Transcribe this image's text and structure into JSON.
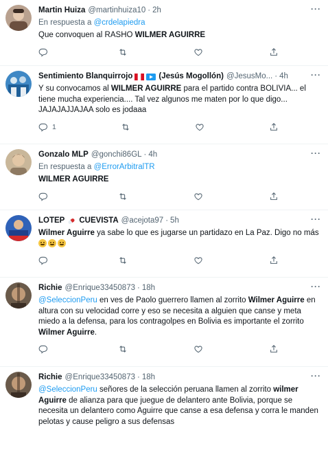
{
  "colors": {
    "link": "#1d9bf0",
    "muted": "#536471",
    "text": "#0f1419"
  },
  "tweets": [
    {
      "name": "Martin Huiza",
      "handle": "@martinhuiza10",
      "time": "2h",
      "reply_prefix": "En respuesta a",
      "reply_to": "@crdelapiedra",
      "text_a": "Que convoquen al RASHO ",
      "text_b": "WILMER AGUIRRE",
      "reply_count": ""
    },
    {
      "name": "Sentimiento Blanquirrojo",
      "name_suffix": "(Jesús Mogollón)",
      "handle": "@JesusMo...",
      "time": "4h",
      "text_a": "Y su convocamos al ",
      "text_b": "WILMER AGUIRRE",
      "text_c": " para el partido contra BOLIVIA... el tiene mucha experiencia.... Tal vez algunos me maten por lo que digo... JAJAJAJJAJAA solo es jodaaa",
      "reply_count": "1"
    },
    {
      "name": "Gonzalo MLP",
      "handle": "@gonchi86GL",
      "time": "4h",
      "reply_prefix": "En respuesta a",
      "reply_to": "@ErrorArbitralTR",
      "text_a": "WILMER AGUIRRE",
      "reply_count": ""
    },
    {
      "name": "LOTEP",
      "name_suffix": "CUEVISTA",
      "handle": "@acejota97",
      "time": "5h",
      "text_a": "Wilmer Aguirre",
      "text_b": " ya sabe lo que es jugarse un partidazo en La Paz. Digo no más ",
      "reply_count": ""
    },
    {
      "name": "Richie",
      "handle": "@Enrique33450873",
      "time": "18h",
      "mention": "@SeleccionPeru",
      "text_a": " en ves de Paolo guerrero llamen al zorrito ",
      "text_b": "Wilmer Aguirre",
      "text_c": " en altura con su velocidad corre y eso se necesita a alguien que canse y meta miedo a la defensa, para los contragolpes en Bolivia es importante el zorrito ",
      "text_d": "Wilmer Aguirre",
      "text_e": ".",
      "reply_count": ""
    },
    {
      "name": "Richie",
      "handle": "@Enrique33450873",
      "time": "18h",
      "mention": "@SeleccionPeru",
      "text_a": " señores de la selección peruana llamen al zorrito ",
      "text_b": "wilmer Aguirre",
      "text_c": " de alianza para que juegue de delantero ante Bolivia, porque se necesita un delantero como Aguirre que canse a esa defensa y corra le manden pelotas y cause peligro a sus defensas",
      "reply_count": ""
    }
  ],
  "icons": {
    "reply": "reply-icon",
    "retweet": "retweet-icon",
    "like": "like-icon",
    "share": "share-icon",
    "more": "more-icon"
  },
  "more_label": "···",
  "dot": "·"
}
